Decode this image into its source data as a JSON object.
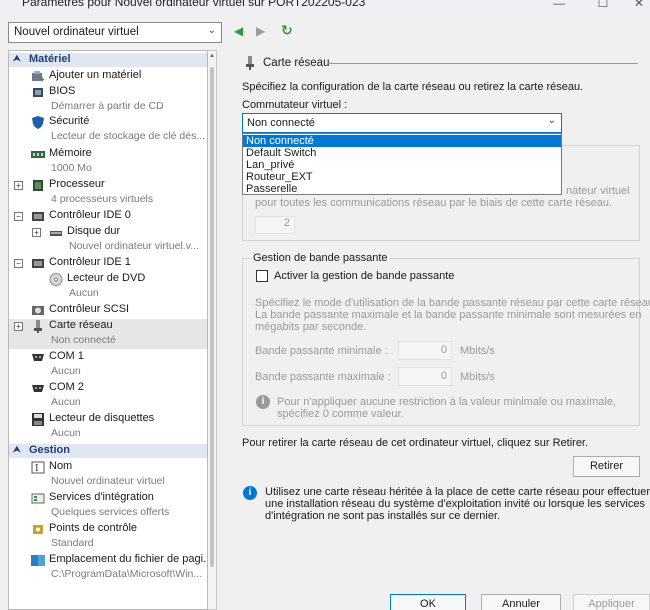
{
  "window": {
    "title": "Paramètres pour Nouvel ordinateur virtuel sur PORT202205-023",
    "minimize": "—",
    "maximize": "☐",
    "close": "✕"
  },
  "vm_selector": {
    "value": "Nouvel ordinateur virtuel"
  },
  "nav": {
    "back": "◀",
    "forward": "▶",
    "refresh": "↻"
  },
  "sidebar": {
    "hardware_header": "Matériel",
    "management_header": "Gestion",
    "items": [
      {
        "label": "Ajouter un matériel",
        "sub": ""
      },
      {
        "label": "BIOS",
        "sub": "Démarrer à partir de CD"
      },
      {
        "label": "Sécurité",
        "sub": "Lecteur de stockage de clé dés..."
      },
      {
        "label": "Mémoire",
        "sub": "1000 Mo"
      },
      {
        "label": "Processeur",
        "sub": "4 processeurs virtuels"
      },
      {
        "label": "Contrôleur IDE 0",
        "sub": ""
      },
      {
        "label": "Disque dur",
        "sub": "Nouvel ordinateur virtuel.v..."
      },
      {
        "label": "Contrôleur IDE 1",
        "sub": ""
      },
      {
        "label": "Lecteur de DVD",
        "sub": "Aucun"
      },
      {
        "label": "Contrôleur SCSI",
        "sub": ""
      },
      {
        "label": "Carte réseau",
        "sub": "Non connecté"
      },
      {
        "label": "COM 1",
        "sub": "Aucun"
      },
      {
        "label": "COM 2",
        "sub": "Aucun"
      },
      {
        "label": "Lecteur de disquettes",
        "sub": "Aucun"
      }
    ],
    "management_items": [
      {
        "label": "Nom",
        "sub": "Nouvel ordinateur virtuel"
      },
      {
        "label": "Services d'intégration",
        "sub": "Quelques services offerts"
      },
      {
        "label": "Points de contrôle",
        "sub": "Standard"
      },
      {
        "label": "Emplacement du fichier de pagi...",
        "sub": "C:\\ProgramData\\Microsoft\\Win..."
      }
    ]
  },
  "content": {
    "header": "Carte réseau",
    "intro": "Spécifiez la configuration de la carte réseau ou retirez la carte réseau.",
    "switch_label": "Commutateur virtuel :",
    "switch_value": "Non connecté",
    "switch_options": [
      "Non connecté",
      "Default Switch",
      "Lan_privé",
      "Routeur_EXT",
      "Passerelle"
    ],
    "vlan_text_partial": "nateur virtuel",
    "vlan_text_line2": "pour toutes les communications réseau par le biais de cette carte réseau.",
    "vlan_value": "2",
    "bandwidth_group": "Gestion de bande passante",
    "bandwidth_checkbox": "Activer la gestion de bande passante",
    "bandwidth_desc_1": "Spécifiez le mode d'utilisation de la bande passante réseau par cette carte réseau.",
    "bandwidth_desc_2": "La bande passante maximale et la bande passante minimale sont mesurées en",
    "bandwidth_desc_3": "mégabits par seconde.",
    "min_label": "Bande passante minimale :",
    "min_value": "0",
    "max_label": "Bande passante maximale :",
    "max_value": "0",
    "unit": "Mbits/s",
    "no_limit_1": "Pour n'appliquer aucune restriction à la valeur minimale ou maximale,",
    "no_limit_2": "spécifiez 0 comme valeur.",
    "remove_text": "Pour retirer la carte réseau de cet ordinateur virtuel, cliquez sur Retirer.",
    "remove_button": "Retirer",
    "legacy_1": "Utilisez une carte réseau héritée à la place de cette carte réseau pour effectuer",
    "legacy_2": "une installation réseau du système d'exploitation invité ou lorsque les services",
    "legacy_3": "d'intégration ne sont pas installés sur ce dernier."
  },
  "footer": {
    "ok": "OK",
    "cancel": "Annuler",
    "apply": "Appliquer"
  },
  "colors": {
    "accent": "#0078d7",
    "header_bg": "#dfe7f2",
    "header_text": "#1f3f73"
  }
}
